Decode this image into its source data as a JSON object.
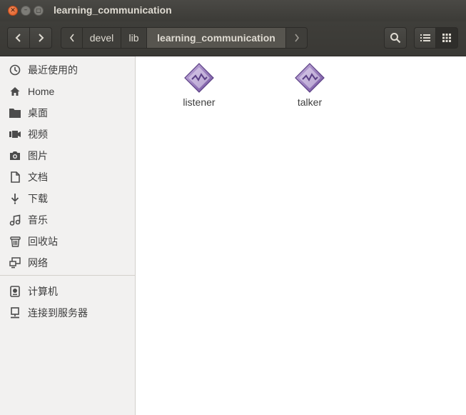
{
  "window": {
    "title": "learning_communication"
  },
  "pathbar": {
    "segments": [
      "devel",
      "lib",
      "learning_communication"
    ]
  },
  "sidebar": {
    "items": [
      {
        "label": "最近使用的",
        "icon": "recent-icon"
      },
      {
        "label": "Home",
        "icon": "home-icon"
      },
      {
        "label": "桌面",
        "icon": "folder-icon"
      },
      {
        "label": "视频",
        "icon": "video-icon"
      },
      {
        "label": "图片",
        "icon": "camera-icon"
      },
      {
        "label": "文档",
        "icon": "document-icon"
      },
      {
        "label": "下载",
        "icon": "download-icon"
      },
      {
        "label": "音乐",
        "icon": "music-icon"
      },
      {
        "label": "回收站",
        "icon": "trash-icon"
      },
      {
        "label": "网络",
        "icon": "network-icon"
      },
      {
        "label": "计算机",
        "icon": "computer-icon"
      },
      {
        "label": "连接到服务器",
        "icon": "connect-server-icon"
      }
    ]
  },
  "files": [
    {
      "name": "listener",
      "icon": "executable-icon"
    },
    {
      "name": "talker",
      "icon": "executable-icon"
    }
  ],
  "colors": {
    "titlebar": "#3c3b37",
    "close": "#e05d26",
    "sidebar": "#f2f1f0",
    "content": "#ffffff"
  }
}
